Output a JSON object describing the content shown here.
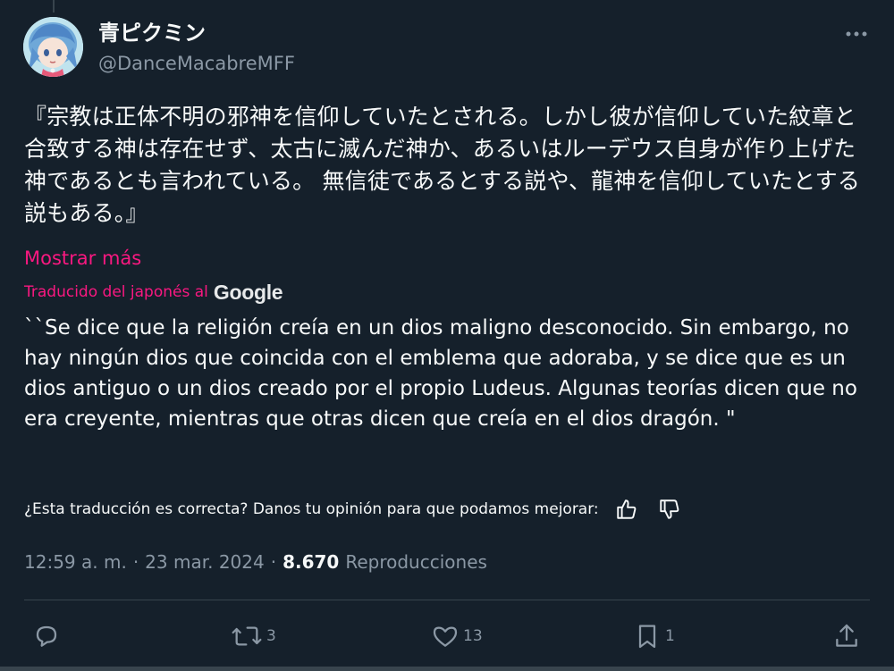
{
  "author": {
    "display_name": "青ピクミン",
    "handle": "@DanceMacabreMFF"
  },
  "tweet": {
    "text": "『宗教は正体不明の邪神を信仰していたとされる。しかし彼が信仰していた紋章と合致する神は存在せず、太古に滅んだ神か、あるいはルーデウス自身が作り上げた神であるとも言われている。 無信徒であるとする説や、龍神を信仰していたとする説もある。』",
    "show_more": "Mostrar más"
  },
  "translation": {
    "label": "Traducido del japonés al",
    "provider": "Google",
    "text": "``Se dice que la religión creía en un dios maligno desconocido. Sin embargo, no hay ningún dios que coincida con el emblema que adoraba, y se dice que es un dios antiguo o un dios creado por el propio Ludeus. Algunas teorías dicen que no era creyente, mientras que otras dicen que creía en el dios dragón. \"",
    "feedback_prompt": "¿Esta traducción es correcta? Danos tu opinión para que podamos mejorar:"
  },
  "meta": {
    "time": "12:59 a. m.",
    "separator": "·",
    "date": "23 mar. 2024",
    "views": "8.670",
    "views_label": "Reproducciones"
  },
  "actions": {
    "reply_count": "",
    "retweet_count": "3",
    "like_count": "13",
    "bookmark_count": "1"
  },
  "icons": {
    "more": "more-horizontal-icon",
    "thumbs_up": "thumbs-up-icon",
    "thumbs_down": "thumbs-down-icon",
    "reply": "reply-icon",
    "retweet": "retweet-icon",
    "like": "heart-icon",
    "bookmark": "bookmark-icon",
    "share": "share-icon"
  },
  "colors": {
    "background": "#15202b",
    "text": "#f7f9f9",
    "secondary_text": "#8b98a5",
    "accent": "#f91880",
    "divider": "#38444d"
  }
}
